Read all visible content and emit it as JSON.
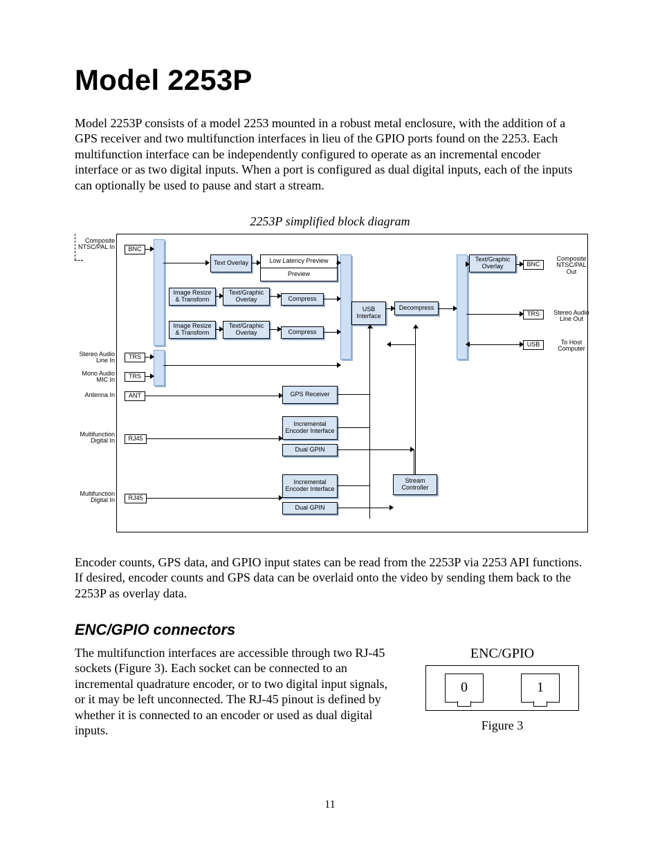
{
  "title": "Model 2253P",
  "para1": "Model 2253P consists of a model 2253 mounted in a robust metal enclosure, with the addition of a GPS receiver and two multifunction interfaces in lieu of the GPIO ports found on the 2253. Each multifunction interface can be independently configured to operate as an incremental encoder interface or as two digital inputs. When a port is configured as dual digital inputs, each of the inputs can optionally be used to pause and start a stream.",
  "diagram_caption": "2253P simplified block diagram",
  "para2": "Encoder counts, GPS data, and GPIO input states can be read from the 2253P via 2253 API functions. If desired, encoder counts and GPS data can be overlaid onto the video by sending them back to the 2253P as overlay data.",
  "section2": "ENC/GPIO connectors",
  "para3": "The multifunction interfaces are accessible through two RJ-45 sockets (Figure 3). Each socket can be connected to an incremental quadrature encoder, or to two digital input signals, or it may be left unconnected. The RJ-45 pinout is defined by whether it is connected to an encoder or used as dual digital inputs.",
  "figure": {
    "heading": "ENC/GPIO",
    "port0": "0",
    "port1": "1",
    "caption": "Figure 3"
  },
  "page": "11",
  "diagram": {
    "left_labels": {
      "comp_in": "Composite NTSC/PAL In",
      "stereo_in": "Stereo Audio Line In",
      "mono_in": "Mono Audio MIC In",
      "ant": "Antenna In",
      "mf1": "Multifunction Digital In",
      "mf2": "Multifunction Digital In"
    },
    "right_labels": {
      "comp_out": "Composite NTSC/PAL Out",
      "stereo_out": "Stereo Audio Line Out",
      "usb": "To Host Computer"
    },
    "ports": {
      "bnc_in": "BNC",
      "bnc_out": "BNC",
      "trs1": "TRS",
      "trs2": "TRS",
      "trs_out": "TRS",
      "ant": "ANT",
      "rj1": "RJ45",
      "rj2": "RJ45",
      "usb": "USB"
    },
    "blocks": {
      "text_overlay": "Text Overlay",
      "llp": "Low Latency Preview",
      "preview": "Preview",
      "resize1": "Image Resize & Transform",
      "resize2": "Image Resize & Transform",
      "tgo1": "Text/Graphic Overlay",
      "tgo2": "Text/Graphic Overlay",
      "tgo_out": "Text/Graphic Overlay",
      "compress1": "Compress",
      "compress2": "Compress",
      "usb_if": "USB Interface",
      "decomp": "Decompress",
      "gps": "GPS Receiver",
      "iei1": "Incremental Encoder Interface",
      "iei2": "Incremental Encoder Interface",
      "gpin1": "Dual GPIN",
      "gpin2": "Dual GPIN",
      "stream": "Stream Controller"
    }
  }
}
